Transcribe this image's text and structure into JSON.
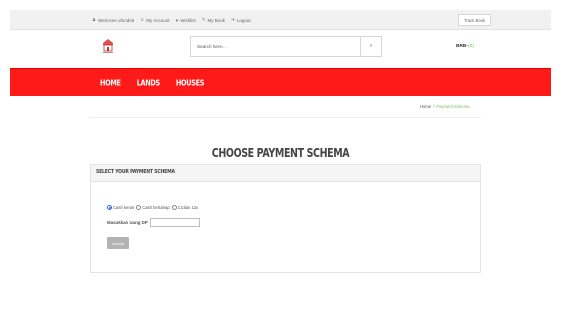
{
  "topbar": {
    "links": [
      {
        "icon": "user-icon",
        "glyph": "♟",
        "label": "Welcome ufonde5"
      },
      {
        "icon": "account-icon",
        "glyph": "♙",
        "label": "My Account"
      },
      {
        "icon": "heart-icon",
        "glyph": "♥",
        "label": "Wishlist"
      },
      {
        "icon": "book-icon",
        "glyph": "✎",
        "label": "My Book"
      },
      {
        "icon": "logout-icon",
        "glyph": "➜",
        "label": "Logout"
      }
    ],
    "track_button": "Track Book"
  },
  "header": {
    "search_placeholder": "Search here...",
    "search_icon": "⌕",
    "cart_label": "BRB-",
    "cart_count": "(0)"
  },
  "nav": {
    "items": [
      "HOME",
      "LANDS",
      "HOUSES"
    ]
  },
  "breadcrumb": {
    "home": "Home",
    "separator": "/",
    "current": "Payment Schema"
  },
  "page": {
    "title": "CHOOSE PAYMENT SCHEMA"
  },
  "panel": {
    "heading": "SELECT YOUR PAYMENT SCHEMA",
    "options": [
      {
        "label": "Cash keras",
        "checked": true
      },
      {
        "label": "Cash bertahap",
        "checked": false
      },
      {
        "label": "Cicilan 12x",
        "checked": false
      }
    ],
    "amount_label": "Masukkan Uang DP",
    "amount_value": "",
    "submit_label": "submit"
  },
  "colors": {
    "nav_bg": "#ff1a1a",
    "accent_green": "#7ab55c",
    "radio_selected": "#2a6fdb",
    "button_gray": "#b3b3b3"
  }
}
